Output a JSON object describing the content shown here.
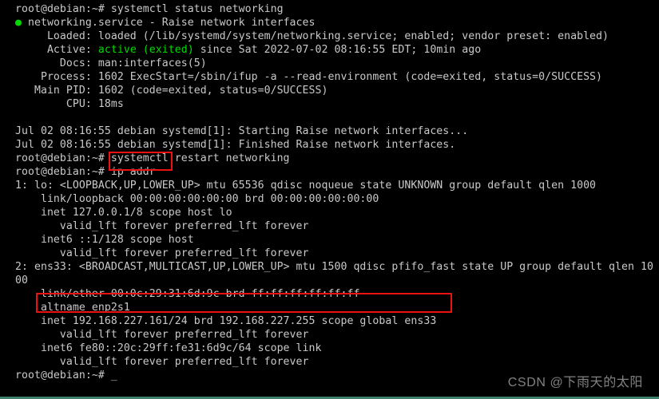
{
  "terminal": {
    "background_color": "#000000",
    "text_color": "#c9c9c9",
    "accent_green": "#00d900",
    "annotation_color": "#ee1111",
    "bottom_edge_color": "#3f7f6b",
    "lines": [
      {
        "id": "l01",
        "text": "root@debian:~# systemctl status networking"
      },
      {
        "id": "l02_pre",
        "text": "● "
      },
      {
        "id": "l02",
        "text": "networking.service - Raise network interfaces"
      },
      {
        "id": "l03",
        "text": "     Loaded: loaded (/lib/systemd/system/networking.service; enabled; vendor preset: enabled)"
      },
      {
        "id": "l04_pre",
        "text": "     Active: "
      },
      {
        "id": "l04_green",
        "text": "active (exited)"
      },
      {
        "id": "l04_post",
        "text": " since Sat 2022-07-02 08:16:55 EDT; 10min ago"
      },
      {
        "id": "l05",
        "text": "       Docs: man:interfaces(5)"
      },
      {
        "id": "l06",
        "text": "    Process: 1602 ExecStart=/sbin/ifup -a --read-environment (code=exited, status=0/SUCCESS)"
      },
      {
        "id": "l07",
        "text": "   Main PID: 1602 (code=exited, status=0/SUCCESS)"
      },
      {
        "id": "l08",
        "text": "        CPU: 18ms"
      },
      {
        "id": "l09",
        "text": ""
      },
      {
        "id": "l10",
        "text": "Jul 02 08:16:55 debian systemd[1]: Starting Raise network interfaces..."
      },
      {
        "id": "l11",
        "text": "Jul 02 08:16:55 debian systemd[1]: Finished Raise network interfaces."
      },
      {
        "id": "l12",
        "text": "root@debian:~# systemctl restart networking"
      },
      {
        "id": "l13",
        "text": "root@debian:~# ip addr"
      },
      {
        "id": "l14",
        "text": "1: lo: <LOOPBACK,UP,LOWER_UP> mtu 65536 qdisc noqueue state UNKNOWN group default qlen 1000"
      },
      {
        "id": "l15",
        "text": "    link/loopback 00:00:00:00:00:00 brd 00:00:00:00:00:00"
      },
      {
        "id": "l16",
        "text": "    inet 127.0.0.1/8 scope host lo"
      },
      {
        "id": "l17",
        "text": "       valid_lft forever preferred_lft forever"
      },
      {
        "id": "l18",
        "text": "    inet6 ::1/128 scope host"
      },
      {
        "id": "l19",
        "text": "       valid_lft forever preferred_lft forever"
      },
      {
        "id": "l20",
        "text": "2: ens33: <BROADCAST,MULTICAST,UP,LOWER_UP> mtu 1500 qdisc pfifo_fast state UP group default qlen 10"
      },
      {
        "id": "l21",
        "text": "00"
      },
      {
        "id": "l22",
        "text": "    link/ether 00:0c:29:31:6d:9c brd ff:ff:ff:ff:ff:ff"
      },
      {
        "id": "l23",
        "text": "    altname enp2s1"
      },
      {
        "id": "l24",
        "text": "    inet 192.168.227.161/24 brd 192.168.227.255 scope global ens33"
      },
      {
        "id": "l25",
        "text": "       valid_lft forever preferred_lft forever"
      },
      {
        "id": "l26",
        "text": "    inet6 fe80::20c:29ff:fe31:6d9c/64 scope link"
      },
      {
        "id": "l27",
        "text": "       valid_lft forever preferred_lft forever"
      },
      {
        "id": "l28",
        "text": "root@debian:~# _"
      }
    ]
  },
  "annotations": {
    "box_ip_addr_target": "ip addr",
    "box_inet_target": "inet 192.168.227.161/24 brd 192.168.227.255 scope global ens33"
  },
  "watermark": {
    "text": "CSDN @下雨天的太阳"
  }
}
